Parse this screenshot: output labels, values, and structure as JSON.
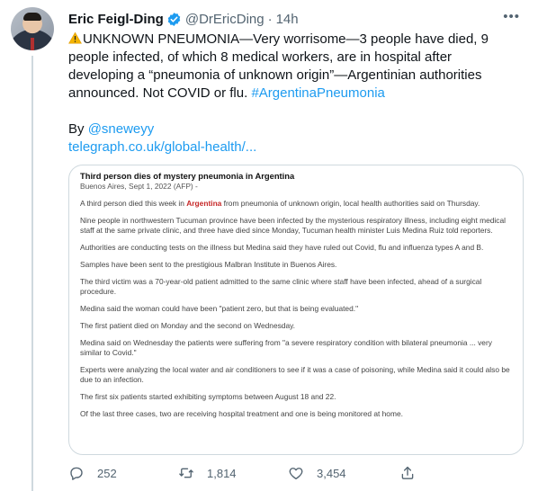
{
  "author": {
    "name": "Eric Feigl-Ding",
    "handle": "@DrEricDing",
    "separator": "·",
    "time": "14h"
  },
  "tweet": {
    "lines": [
      "UNKNOWN PNEUMONIA—Very worrisome—3 people have died, 9",
      "people infected, of which 8 medical workers, are in hospital after",
      "developing a “pneumonia of unknown origin”—Argentinian authorities"
    ],
    "line4_text": "announced. Not COVID or flu. ",
    "hashtag": "#ArgentinaPneumonia",
    "by_prefix": "By ",
    "by_handle": "@sneweyy",
    "url": "telegraph.co.uk/global-health/..."
  },
  "article": {
    "title": "Third person dies of mystery pneumonia in Argentina",
    "dateline": "Buenos Aires, Sept 1, 2022 (AFP) -",
    "p1_pre": "A third person died this week in ",
    "p1_highlight": "Argentina",
    "p1_post": " from pneumonia of unknown origin, local health authorities said on Thursday.",
    "paragraphs": [
      "Nine people in northwestern Tucuman province have been infected by the mysterious respiratory illness, including eight medical staff at the same private clinic, and three have died since Monday, Tucuman health minister Luis Medina Ruiz told reporters.",
      "Authorities are conducting tests on the illness but Medina said they have ruled out Covid, flu and influenza types A and B.",
      "Samples have been sent to the prestigious Malbran Institute in Buenos Aires.",
      "The third victim was a 70-year-old patient admitted to the same clinic where staff have been infected, ahead of a surgical procedure.",
      "Medina said the woman could have been \"patient zero, but that is being evaluated.\"",
      "The first patient died on Monday and the second on Wednesday.",
      "Medina said on Wednesday the patients were suffering from \"a severe respiratory condition with bilateral pneumonia ... very similar to Covid.\"",
      "Experts were analyzing the local water and air conditioners to see if it was a case of poisoning, while Medina said it could also be due to an infection.",
      "The first six patients started exhibiting symptoms between August 18 and 22.",
      "Of the last three cases, two are receiving hospital treatment and one is being monitored at home."
    ]
  },
  "actions": {
    "replies": "252",
    "retweets": "1,814",
    "likes": "3,454"
  },
  "colors": {
    "link": "#1d9bf0",
    "secondary_text": "#536471",
    "highlight": "#c62828"
  },
  "icons": [
    "verified-badge-icon",
    "warning-icon",
    "more-icon",
    "reply-icon",
    "retweet-icon",
    "like-icon",
    "share-icon"
  ]
}
